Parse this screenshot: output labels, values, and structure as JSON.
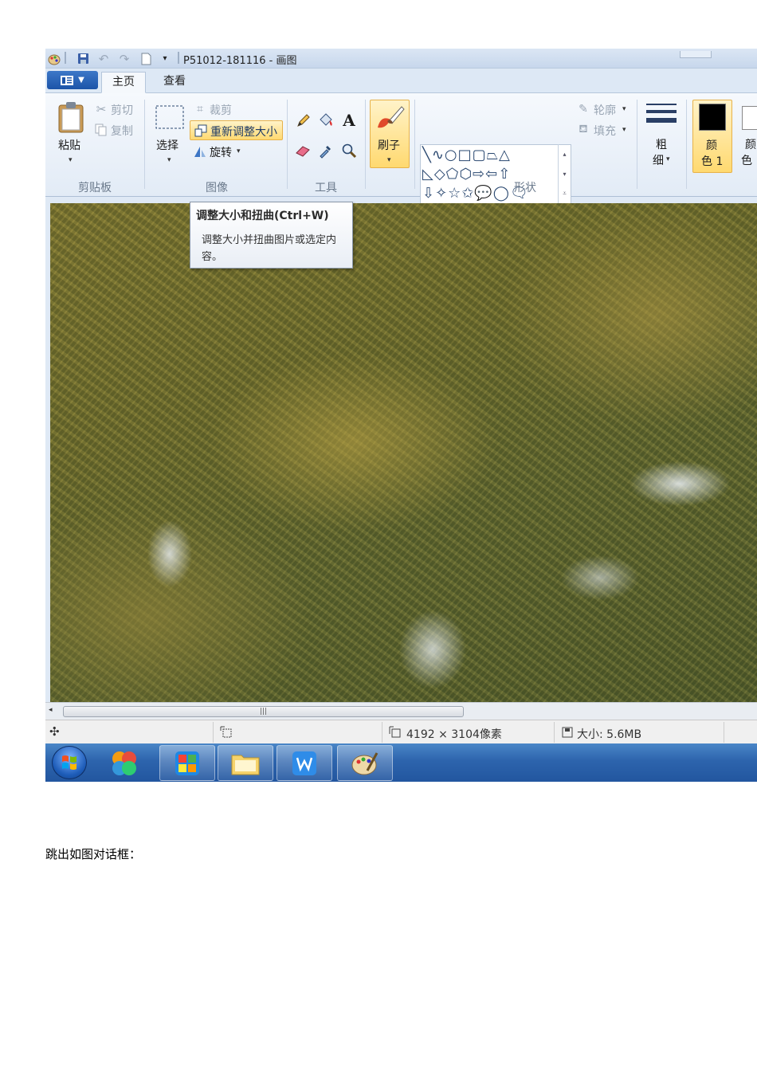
{
  "window": {
    "title": "P51012-181116 - 画图"
  },
  "tabs": {
    "home": "主页",
    "view": "查看"
  },
  "ribbon": {
    "clipboard": {
      "paste": "粘贴",
      "cut": "剪切",
      "copy": "复制",
      "group": "剪贴板"
    },
    "image": {
      "select": "选择",
      "crop": "裁剪",
      "resize": "重新调整大小",
      "rotate": "旋转",
      "group": "图像"
    },
    "tools": {
      "group": "工具"
    },
    "brushes": {
      "label": "刷子"
    },
    "shapes": {
      "outline": "轮廓",
      "fill": "填充",
      "group": "形状"
    },
    "size": {
      "line1": "粗",
      "line2": "细"
    },
    "colors": {
      "color1_line1": "颜",
      "color1_line2": "色 1",
      "color2_line1": "颜",
      "color2_line2": "色",
      "color1_value": "#000000",
      "color2_value": "#ffffff"
    }
  },
  "tooltip": {
    "title": "调整大小和扭曲(Ctrl+W)",
    "body": "调整大小并扭曲图片或选定内容。"
  },
  "statusbar": {
    "dimensions": "4192 × 3104像素",
    "size": "大小: 5.6MB"
  },
  "caption": "跳出如图对话框："
}
